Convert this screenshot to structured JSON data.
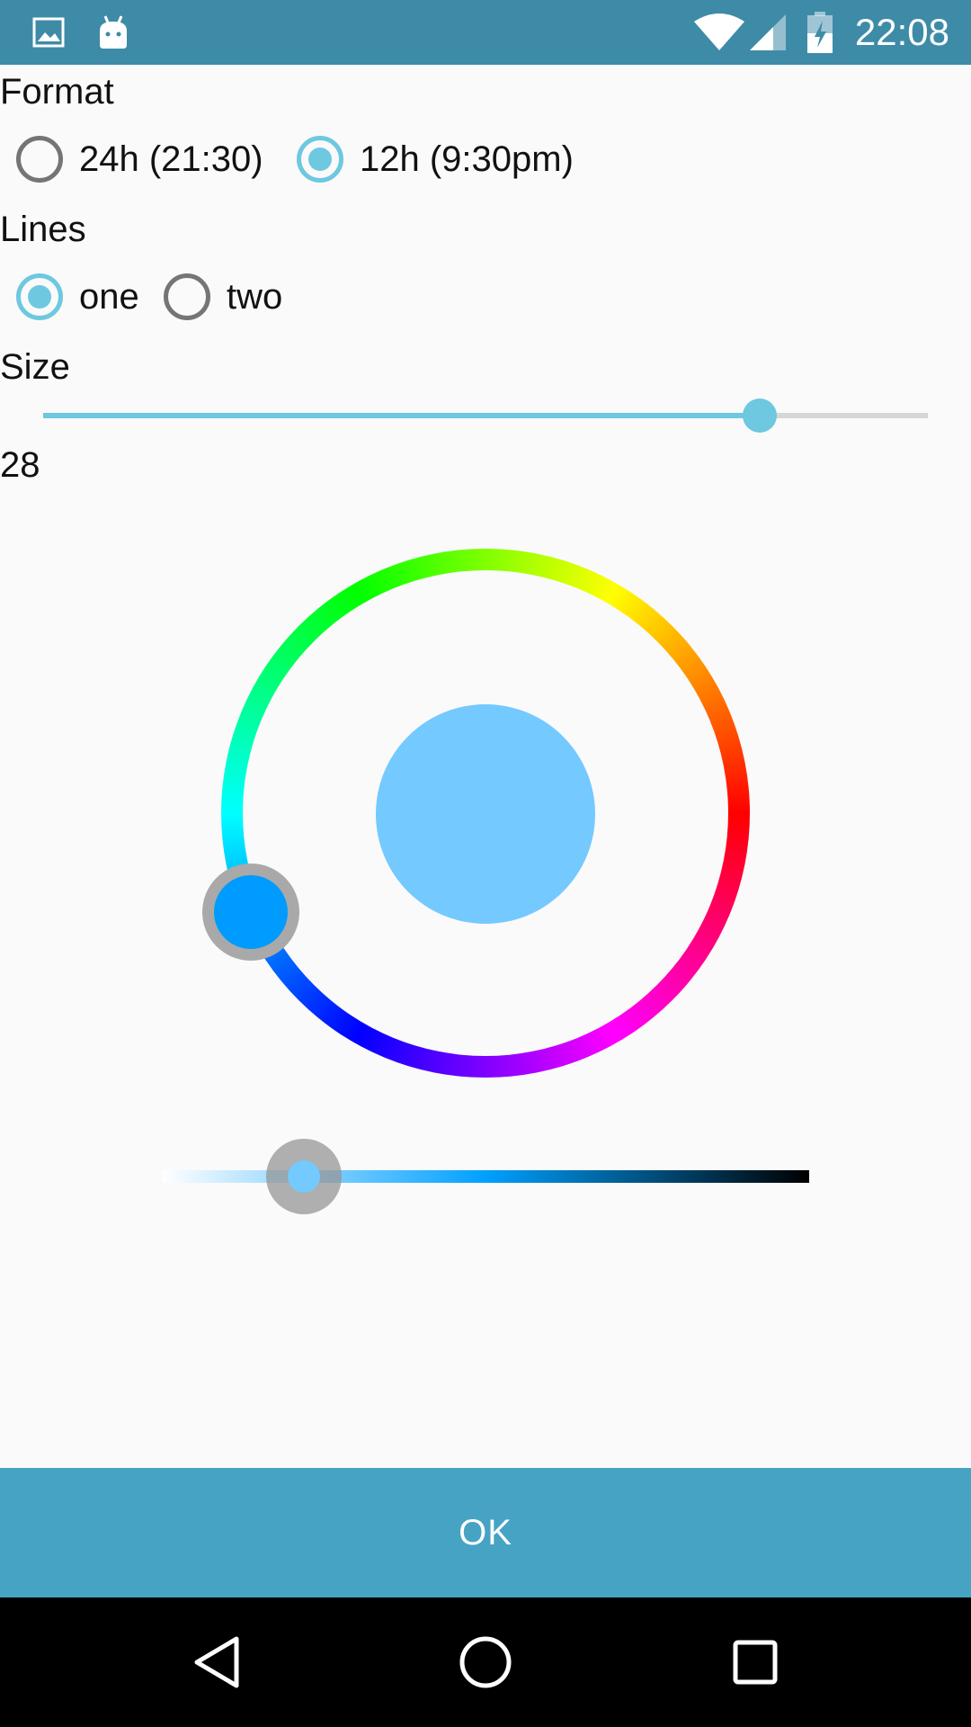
{
  "status_bar": {
    "time": "22:08",
    "left_icons": [
      "image-icon",
      "android-icon"
    ],
    "right_icons": [
      "wifi-icon",
      "signal-icon",
      "battery-charging-icon"
    ],
    "color": "#3E8BA8"
  },
  "format": {
    "label": "Format",
    "options": [
      {
        "label": "24h (21:30)",
        "checked": false
      },
      {
        "label": "12h (9:30pm)",
        "checked": true
      }
    ]
  },
  "lines": {
    "label": "Lines",
    "options": [
      {
        "label": "one",
        "checked": true
      },
      {
        "label": "two",
        "checked": false
      }
    ]
  },
  "size": {
    "label": "Size",
    "value": "28",
    "slider_fraction": 0.81
  },
  "color_picker": {
    "selected_color": "#009BFF",
    "preview_color": "#74C9FF",
    "value_fraction": 0.22
  },
  "ok_button": {
    "label": "OK",
    "color": "#46A3C4"
  },
  "nav_bar": {
    "icons": [
      "back-icon",
      "home-icon",
      "recents-icon"
    ]
  },
  "accent_color": "#6DC8E0"
}
